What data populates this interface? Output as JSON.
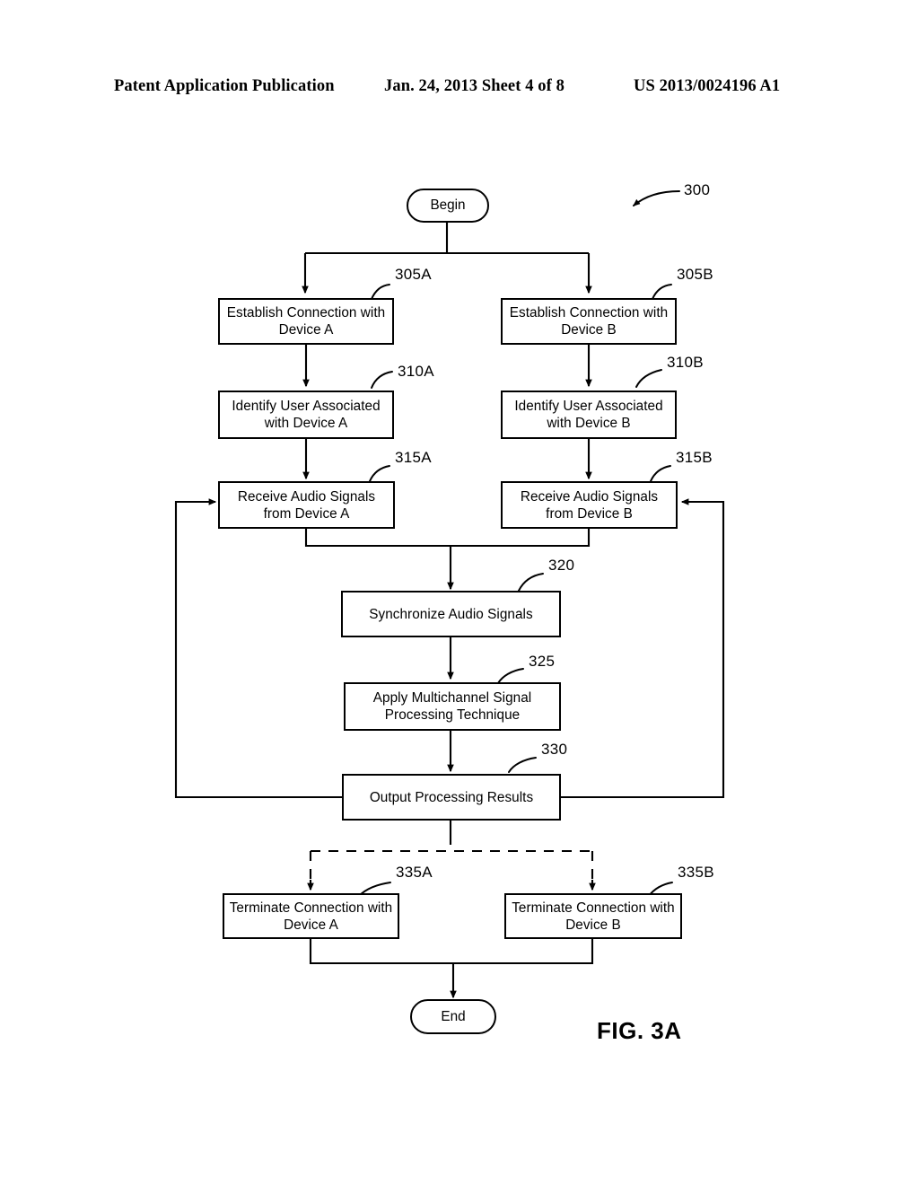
{
  "header": {
    "publication": "Patent Application Publication",
    "date_sheet": "Jan. 24, 2013  Sheet 4 of 8",
    "patent_number": "US 2013/0024196 A1"
  },
  "figure": {
    "caption": "FIG. 3A",
    "diagram_ref": "300"
  },
  "nodes": {
    "begin": {
      "label": "Begin"
    },
    "end": {
      "label": "End"
    },
    "establish_a": {
      "label": "Establish Connection with Device A",
      "ref": "305A"
    },
    "establish_b": {
      "label": "Establish Connection with Device B",
      "ref": "305B"
    },
    "identify_a": {
      "label": "Identify User Associated with Device A",
      "ref": "310A"
    },
    "identify_b": {
      "label": "Identify User Associated with Device B",
      "ref": "310B"
    },
    "receive_a": {
      "label": "Receive Audio Signals from Device A",
      "ref": "315A"
    },
    "receive_b": {
      "label": "Receive Audio Signals from Device B",
      "ref": "315B"
    },
    "synchronize": {
      "label": "Synchronize Audio Signals",
      "ref": "320"
    },
    "apply": {
      "label": "Apply Multichannel Signal Processing Technique",
      "ref": "325"
    },
    "output": {
      "label": "Output Processing Results",
      "ref": "330"
    },
    "terminate_a": {
      "label": "Terminate Connection with Device A",
      "ref": "335A"
    },
    "terminate_b": {
      "label": "Terminate Connection with Device B",
      "ref": "335B"
    }
  },
  "colors": {
    "ink": "#000000",
    "paper": "#ffffff"
  }
}
